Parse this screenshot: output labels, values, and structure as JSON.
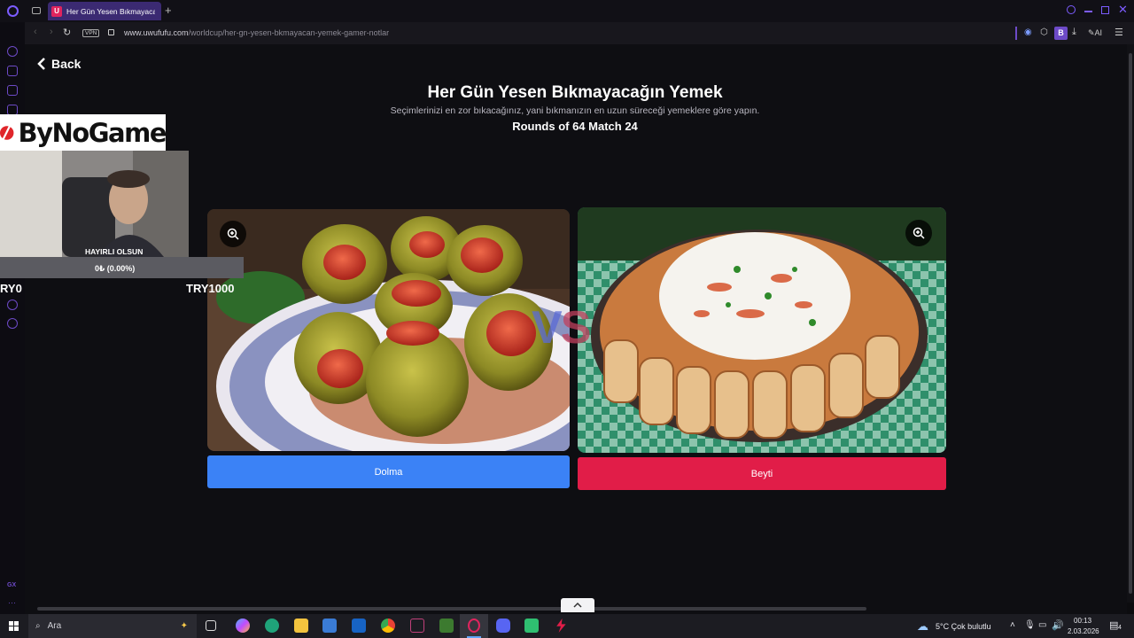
{
  "browser": {
    "tab_title": "Her Gün Yesen Bıkmayacağın Yemek",
    "tab_favicon": "U",
    "url_domain": "www.uwufufu.com",
    "url_path": "/worldcup/her-gn-yesen-bkmayacan-yemek-gamer-notlar",
    "vpn_label": "VPN",
    "ai_label": "AI",
    "profile_letter": "B"
  },
  "page": {
    "back_label": "Back",
    "title": "Her Gün Yesen Bıkmayacağın Yemek",
    "subtitle": "Seçimlerinizi en zor bıkacağınız, yani bıkmanızın en uzun süreceği yemeklere göre yapın.",
    "rounds": "Rounds of 64 Match 24",
    "vs_v": "V",
    "vs_s": "S",
    "left_choice": "Dolma",
    "right_choice": "Beyti",
    "left_color": "#3b82f6",
    "right_color": "#e11d48"
  },
  "overlay": {
    "logo_text": "ByNoGame",
    "donation_title": "HAYIRLI OLSUN",
    "donation_amount": "0₺ (0.00%)",
    "goal_left": "RY0",
    "goal_right": "TRY1000"
  },
  "taskbar": {
    "search_placeholder": "Ara",
    "weather": "5°C  Çok bulutlu",
    "time": "00:13",
    "date": "2.03.2026",
    "notif_count": "4"
  }
}
